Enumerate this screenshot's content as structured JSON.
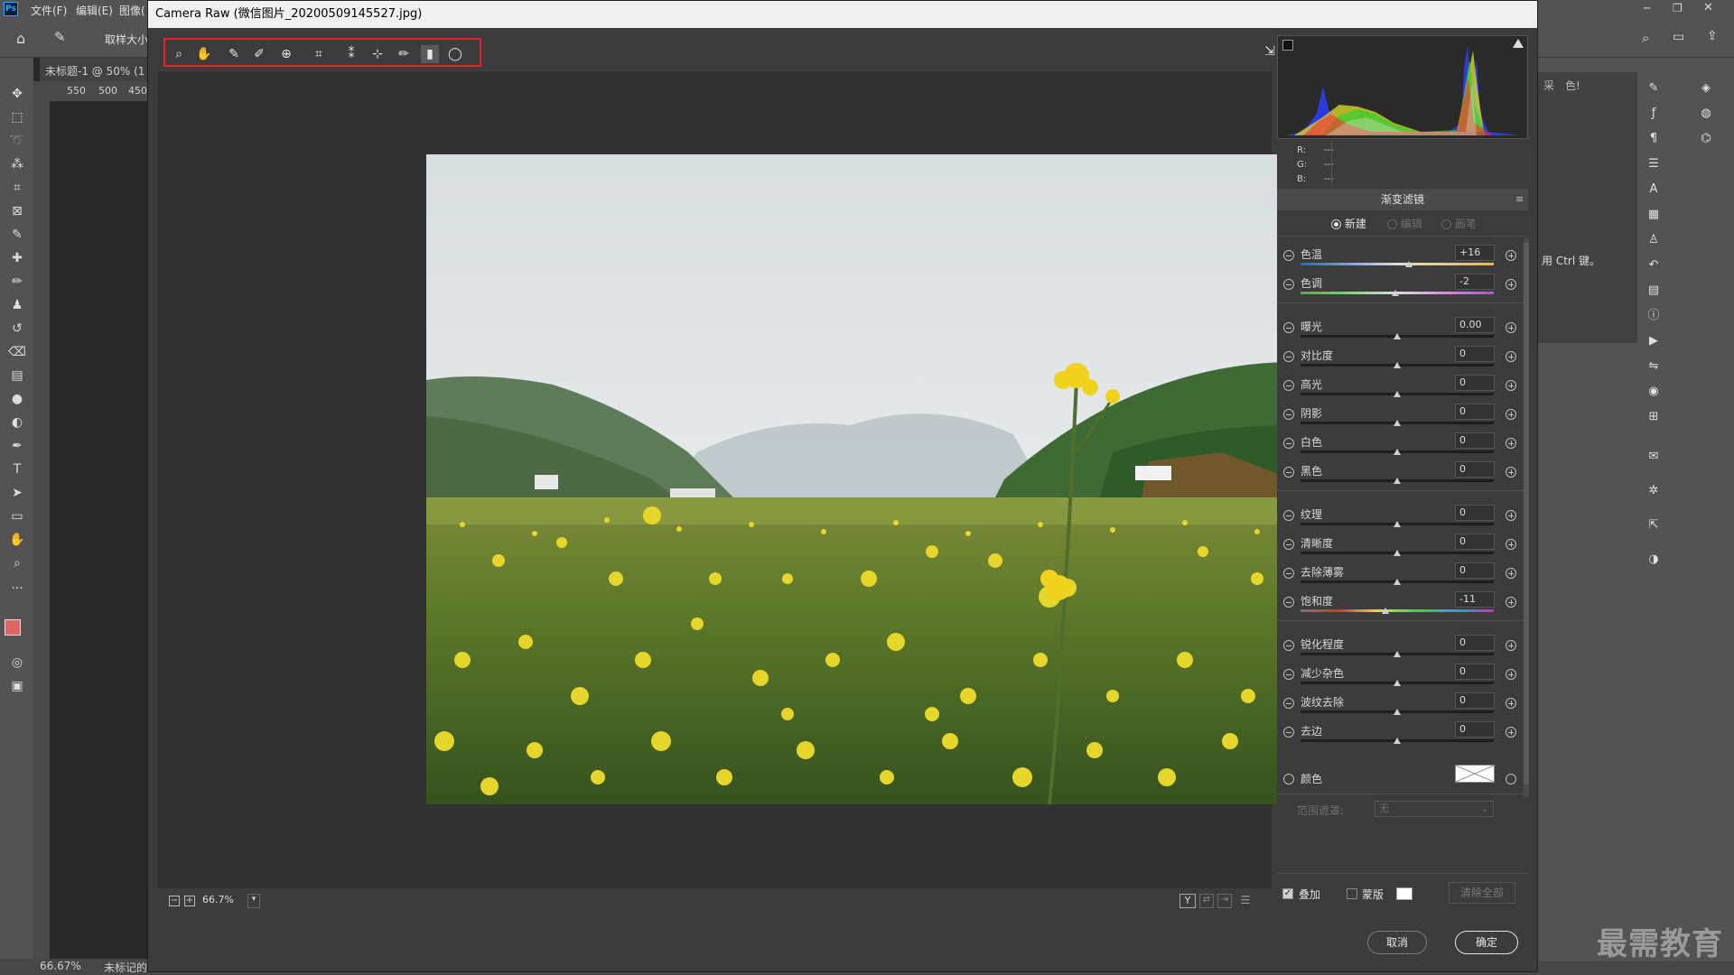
{
  "app": {
    "logo_text": "Ps",
    "menus": [
      "文件(F)",
      "编辑(E)",
      "图像("
    ],
    "optbar_sample_label": "取样大小",
    "doc_tab": "未标题-1 @ 50% (1",
    "ruler_marks": [
      "550",
      "500",
      "450"
    ],
    "status_zoom": "66.67%",
    "status_text": "未标记的",
    "right_panel_hint": "用 Ctrl 键。",
    "right_tabs": [
      "采",
      "色!"
    ]
  },
  "dialog": {
    "title": "Camera Raw (微信图片_20200509145527.jpg)",
    "tools": [
      "zoom-icon",
      "hand-icon",
      "white-balance-icon",
      "color-sampler-icon",
      "target-adjust-icon",
      "crop-icon",
      "red-eye-icon",
      "spot-removal-icon",
      "adjustment-brush-icon",
      "graduated-filter-icon",
      "radial-filter-icon"
    ],
    "zoom_level": "66.7%",
    "cancel_label": "取消",
    "ok_label": "确定"
  },
  "histogram": {
    "r_label": "R:",
    "g_label": "G:",
    "b_label": "B:",
    "r_value": "---",
    "g_value": "---",
    "b_value": "---"
  },
  "panel": {
    "title": "渐变滤镜",
    "mode_new": "新建",
    "mode_edit": "编辑",
    "mode_brush": "画笔",
    "sliders": [
      {
        "label": "色温",
        "value": "+16",
        "pos": 0.56
      },
      {
        "label": "色调",
        "value": "-2",
        "pos": 0.49
      },
      {
        "label": "曝光",
        "value": "0.00",
        "pos": 0.5
      },
      {
        "label": "对比度",
        "value": "0",
        "pos": 0.5
      },
      {
        "label": "高光",
        "value": "0",
        "pos": 0.5
      },
      {
        "label": "阴影",
        "value": "0",
        "pos": 0.5
      },
      {
        "label": "白色",
        "value": "0",
        "pos": 0.5
      },
      {
        "label": "黑色",
        "value": "0",
        "pos": 0.5
      },
      {
        "label": "纹理",
        "value": "0",
        "pos": 0.5
      },
      {
        "label": "清晰度",
        "value": "0",
        "pos": 0.5
      },
      {
        "label": "去除薄雾",
        "value": "0",
        "pos": 0.5
      },
      {
        "label": "饱和度",
        "value": "-11",
        "pos": 0.44
      },
      {
        "label": "锐化程度",
        "value": "0",
        "pos": 0.5
      },
      {
        "label": "减少杂色",
        "value": "0",
        "pos": 0.5
      },
      {
        "label": "波纹去除",
        "value": "0",
        "pos": 0.5
      },
      {
        "label": "去边",
        "value": "0",
        "pos": 0.5
      }
    ],
    "color_label": "颜色",
    "range_mask_label": "范围遮罩:",
    "range_mask_value": "无",
    "overlay_label": "叠加",
    "mask_label": "蒙版",
    "clear_all_label": "清除全部"
  },
  "watermark": "最需教育"
}
